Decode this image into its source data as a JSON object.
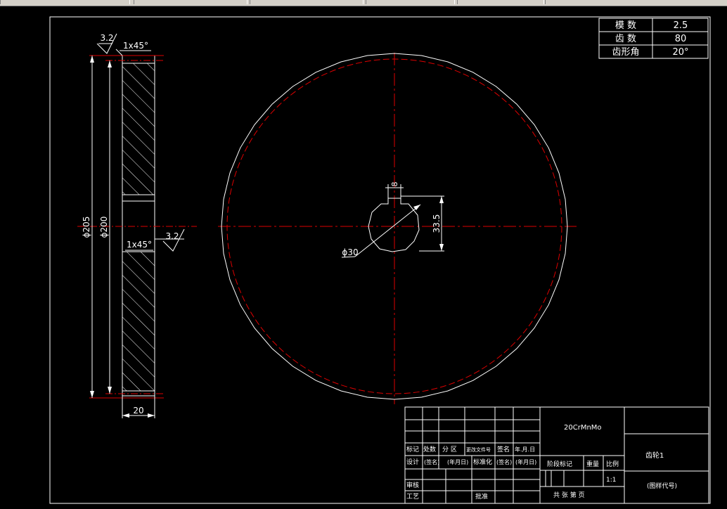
{
  "gear_params": {
    "module_label": "模 数",
    "module_value": "2.5",
    "teeth_label": "齿 数",
    "teeth_value": "80",
    "pressure_angle_label": "齿形角",
    "pressure_angle_value": "20°"
  },
  "side_view": {
    "roughness_top": "3.2",
    "chamfer_top": "1x45°",
    "roughness_right": "3.2",
    "chamfer_bottom": "1x45°",
    "outer_diameter": "ϕ205",
    "pitch_diameter": "ϕ200",
    "width": "20"
  },
  "front_view": {
    "key_width": "8",
    "key_depth": "33.5",
    "bore_diameter": "ϕ30"
  },
  "title_block": {
    "material": "20CrMnMo",
    "part_name": "齿轮1",
    "drawing_code": "(图样代号)",
    "scale": "1:1",
    "sheets": "共  张 第  页",
    "rev_mark": "标记",
    "rev_count": "处数",
    "rev_zone": "分 区",
    "rev_doc": "更改文件号",
    "rev_sign": "签名",
    "rev_date": "年.月.日",
    "design": "设计",
    "design_sign": "(签名)",
    "design_date": "(年月日)",
    "standard": "标准化",
    "std_sign": "(签名)",
    "std_date": "(年月日)",
    "stage_mark": "阶段标记",
    "weight": "重量",
    "scale_label": "比例",
    "review": "审核",
    "process": "工艺",
    "approve": "批准"
  }
}
